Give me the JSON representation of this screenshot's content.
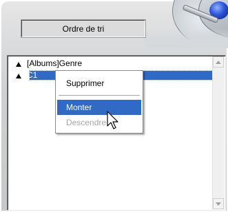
{
  "toolbar": {
    "sort_order_label": "Ordre de tri"
  },
  "list": {
    "items": [
      {
        "label": "[Albums]Genre",
        "selected": false
      },
      {
        "label": "C1",
        "selected": true
      }
    ]
  },
  "context_menu": {
    "items": [
      {
        "label": "Supprimer",
        "state": "normal"
      },
      {
        "label": "Monter",
        "state": "highlighted"
      },
      {
        "label": "Descendre",
        "state": "disabled"
      }
    ]
  },
  "colors": {
    "selection": "#316ac5",
    "panel": "#cfd1d3",
    "disabled_text": "#a8a8a8"
  },
  "icons": [
    "sort-triangle-icon",
    "scroll-up-icon",
    "scroll-down-icon",
    "pointer-cursor-icon"
  ]
}
